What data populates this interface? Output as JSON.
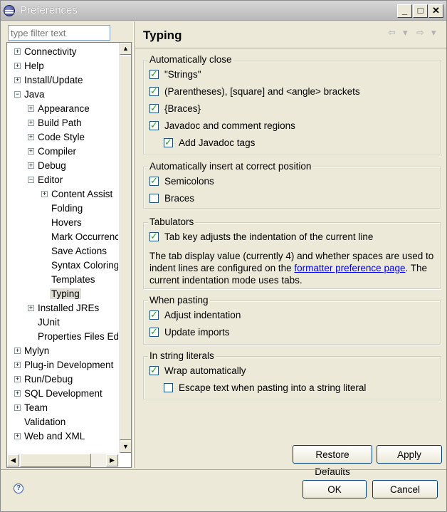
{
  "window": {
    "title": "Preferences"
  },
  "titlebar_buttons": {
    "minimize": "_",
    "maximize": "□",
    "close": "✕"
  },
  "filter": {
    "placeholder": "type filter text"
  },
  "tree": {
    "items": [
      {
        "label": "Connectivity",
        "expander": "+"
      },
      {
        "label": "Help",
        "expander": "+"
      },
      {
        "label": "Install/Update",
        "expander": "+"
      },
      {
        "label": "Java",
        "expander": "−"
      },
      {
        "label": "Appearance",
        "expander": "+"
      },
      {
        "label": "Build Path",
        "expander": "+"
      },
      {
        "label": "Code Style",
        "expander": "+"
      },
      {
        "label": "Compiler",
        "expander": "+"
      },
      {
        "label": "Debug",
        "expander": "+"
      },
      {
        "label": "Editor",
        "expander": "−"
      },
      {
        "label": "Content Assist",
        "expander": "+"
      },
      {
        "label": "Folding"
      },
      {
        "label": "Hovers"
      },
      {
        "label": "Mark Occurrences"
      },
      {
        "label": "Save Actions"
      },
      {
        "label": "Syntax Coloring"
      },
      {
        "label": "Templates"
      },
      {
        "label": "Typing",
        "selected": true
      },
      {
        "label": "Installed JREs",
        "expander": "+"
      },
      {
        "label": "JUnit"
      },
      {
        "label": "Properties Files Editor"
      },
      {
        "label": "Mylyn",
        "expander": "+"
      },
      {
        "label": "Plug-in Development",
        "expander": "+"
      },
      {
        "label": "Run/Debug",
        "expander": "+"
      },
      {
        "label": "SQL Development",
        "expander": "+"
      },
      {
        "label": "Team",
        "expander": "+"
      },
      {
        "label": "Validation"
      },
      {
        "label": "Web and XML",
        "expander": "+"
      }
    ]
  },
  "page": {
    "title": "Typing"
  },
  "nav": {
    "back": "⇦",
    "back_menu": "▾",
    "forward": "⇨",
    "forward_menu": "▾"
  },
  "groups": {
    "auto_close": {
      "title": "Automatically close",
      "items": [
        {
          "label": "\"Strings\"",
          "checked": true
        },
        {
          "label": "(Parentheses), [square] and <angle> brackets",
          "checked": true
        },
        {
          "label": "{Braces}",
          "checked": true
        },
        {
          "label": "Javadoc and comment regions",
          "checked": true
        },
        {
          "label": "Add Javadoc tags",
          "checked": true
        }
      ]
    },
    "auto_insert": {
      "title": "Automatically insert at correct position",
      "items": [
        {
          "label": "Semicolons",
          "checked": true
        },
        {
          "label": "Braces",
          "checked": false
        }
      ]
    },
    "tabulators": {
      "title": "Tabulators",
      "items": [
        {
          "label": "Tab key adjusts the indentation of the current line",
          "checked": true
        }
      ],
      "text_before": "The tab display value (currently 4) and whether spaces are used to indent lines are configured on the ",
      "link": "formatter preference page",
      "text_after": ". The current indentation mode uses tabs."
    },
    "pasting": {
      "title": "When pasting",
      "items": [
        {
          "label": "Adjust indentation",
          "checked": true
        },
        {
          "label": "Update imports",
          "checked": true
        }
      ]
    },
    "string_literals": {
      "title": "In string literals",
      "items": [
        {
          "label": "Wrap automatically",
          "checked": true
        },
        {
          "label": "Escape text when pasting into a string literal",
          "checked": false
        }
      ]
    }
  },
  "buttons": {
    "restore": "Restore Defaults",
    "apply": "Apply",
    "ok": "OK",
    "cancel": "Cancel",
    "help": "?"
  },
  "scroll": {
    "up": "▲",
    "down": "▼",
    "left": "◀",
    "right": "▶"
  }
}
